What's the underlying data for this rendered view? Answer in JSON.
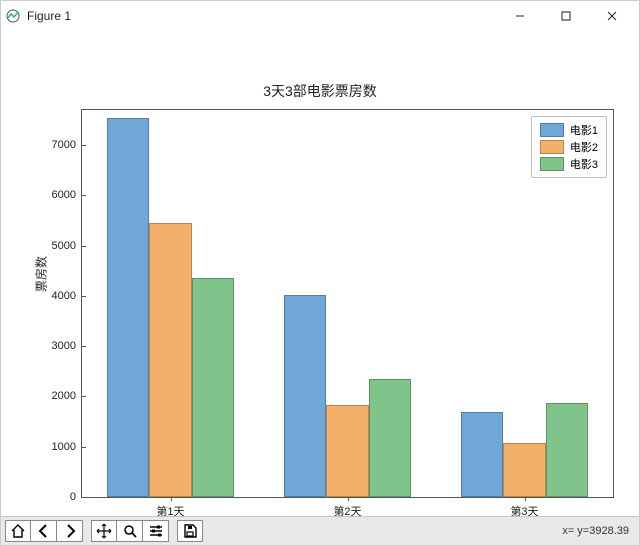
{
  "window": {
    "title": "Figure 1"
  },
  "status": {
    "coords": "x= y=3928.39"
  },
  "chart_data": {
    "type": "bar",
    "title": "3天3部电影票房数",
    "xlabel": "",
    "ylabel": "票房数",
    "categories": [
      "第1天",
      "第2天",
      "第3天"
    ],
    "series": [
      {
        "name": "电影1",
        "values": [
          7548,
          4013,
          1696
        ]
      },
      {
        "name": "电影2",
        "values": [
          5453,
          1840,
          1080
        ]
      },
      {
        "name": "电影3",
        "values": [
          4348,
          2345,
          1879
        ]
      }
    ],
    "ylim": [
      0,
      7700
    ],
    "yticks": [
      0,
      1000,
      2000,
      3000,
      4000,
      5000,
      6000,
      7000
    ],
    "legend_position": "upper right"
  }
}
